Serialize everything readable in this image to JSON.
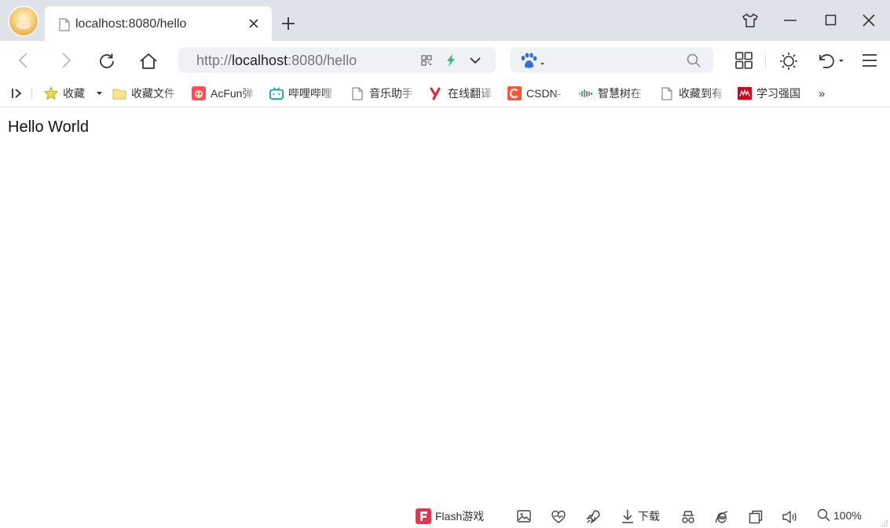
{
  "tab": {
    "title": "localhost:8080/hello"
  },
  "address": {
    "scheme": "http://",
    "host": "localhost",
    "rest": ":8080/hello"
  },
  "search": {
    "placeholder": ""
  },
  "bookmarks": [
    {
      "label": "收藏",
      "icon": "star-icon"
    },
    {
      "label": "收藏文件",
      "icon": "folder-icon"
    },
    {
      "label": "AcFun弹",
      "icon": "acfun-icon"
    },
    {
      "label": "哔哩哔哩",
      "icon": "bilibili-icon"
    },
    {
      "label": "音乐助手",
      "icon": "page-icon"
    },
    {
      "label": "在线翻译",
      "icon": "youdao-icon"
    },
    {
      "label": "CSDN-",
      "icon": "csdn-icon"
    },
    {
      "label": "智慧树在",
      "icon": "zhihuishu-icon"
    },
    {
      "label": "收藏到有",
      "icon": "page-icon"
    },
    {
      "label": "学习强国",
      "icon": "xuexi-icon"
    }
  ],
  "bookmarks_more": "»",
  "content": {
    "text": "Hello World"
  },
  "statusbar": {
    "flash_label": "Flash游戏",
    "download_label": "下载",
    "zoom": "100%"
  },
  "colors": {
    "titlebar": "#dfe2e8",
    "bolt": "#2ec36b",
    "engine": "#2f6fe0",
    "csdn": "#fc5531",
    "xuexi": "#d9001b"
  }
}
